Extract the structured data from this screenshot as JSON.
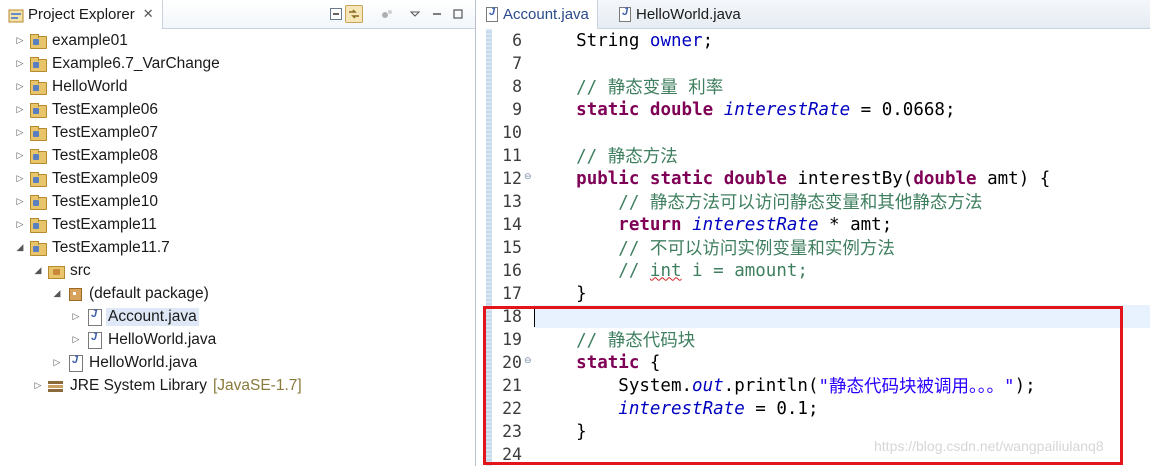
{
  "explorer": {
    "title": "Project Explorer",
    "close": "✕",
    "items": [
      {
        "label": "example01",
        "icon": "java-project-icon",
        "twisty": "▷"
      },
      {
        "label": "Example6.7_VarChange",
        "icon": "java-project-icon",
        "twisty": "▷"
      },
      {
        "label": "HelloWorld",
        "icon": "java-project-icon",
        "twisty": "▷"
      },
      {
        "label": "TestExample06",
        "icon": "java-project-icon",
        "twisty": "▷"
      },
      {
        "label": "TestExample07",
        "icon": "java-project-icon",
        "twisty": "▷"
      },
      {
        "label": "TestExample08",
        "icon": "java-project-icon",
        "twisty": "▷"
      },
      {
        "label": "TestExample09",
        "icon": "java-project-icon",
        "twisty": "▷"
      },
      {
        "label": "TestExample10",
        "icon": "java-project-icon",
        "twisty": "▷"
      },
      {
        "label": "TestExample11",
        "icon": "java-project-icon",
        "twisty": "▷"
      },
      {
        "label": "TestExample11.7",
        "icon": "java-project-icon",
        "twisty": "◢"
      },
      {
        "label": "src",
        "icon": "source-folder-icon",
        "twisty": "◢"
      },
      {
        "label": "(default package)",
        "icon": "package-icon",
        "twisty": "◢"
      },
      {
        "label": "Account.java",
        "icon": "java-file-icon",
        "twisty": "▷",
        "selected": true
      },
      {
        "label": "HelloWorld.java",
        "icon": "java-file-icon",
        "twisty": "▷"
      },
      {
        "label": "HelloWorld.java",
        "icon": "java-file-icon",
        "twisty": "▷"
      },
      {
        "label": "JRE System Library",
        "icon": "library-icon",
        "twisty": "▷",
        "decoration": "[JavaSE-1.7]"
      }
    ]
  },
  "editor": {
    "tabs": [
      {
        "label": "Account.java",
        "active": true
      },
      {
        "label": "HelloWorld.java",
        "active": false
      }
    ],
    "line_numbers": [
      "6",
      "7",
      "8",
      "9",
      "10",
      "11",
      "12",
      "13",
      "14",
      "15",
      "16",
      "17",
      "18",
      "19",
      "20",
      "21",
      "22",
      "23",
      "24"
    ],
    "folds": {
      "12": "⊖",
      "20": "⊖"
    },
    "lines": {
      "l6": {
        "a": "    String ",
        "b": "owner",
        "c": ";"
      },
      "l8": {
        "a": "    // 静态变量 利率"
      },
      "l9": {
        "a": "    ",
        "kw1": "static",
        "sp1": " ",
        "kw2": "double",
        "sp2": " ",
        "f": "interestRate",
        "c": " = 0.0668;"
      },
      "l11": {
        "a": "    // 静态方法"
      },
      "l12": {
        "a": "    ",
        "kw1": "public",
        "sp1": " ",
        "kw2": "static",
        "sp2": " ",
        "kw3": "double",
        "b": " interestBy(",
        "kw4": "double",
        "c": " amt) {"
      },
      "l13": {
        "a": "        // 静态方法可以访问静态变量和其他静态方法"
      },
      "l14": {
        "a": "        ",
        "kw": "return",
        "sp": " ",
        "f": "interestRate",
        "c": " * amt;"
      },
      "l15": {
        "a": "        // 不可以访问实例变量和实例方法"
      },
      "l16": {
        "a": "        // ",
        "u": "int",
        "c": " i = amount;"
      },
      "l17": {
        "a": "    }"
      },
      "l19": {
        "a": "    // 静态代码块"
      },
      "l20": {
        "a": "    ",
        "kw": "static",
        "c": " {"
      },
      "l21": {
        "a": "        System.",
        "f": "out",
        "b": ".println(",
        "s": "\"静态代码块被调用。。。\"",
        "c": ");"
      },
      "l22": {
        "a": "        ",
        "f": "interestRate",
        "c": " = 0.1;"
      },
      "l23": {
        "a": "    }"
      }
    }
  },
  "watermark": "https://blog.csdn.net/wangpailiulanq8",
  "colors": {
    "keyword": "#7f0055",
    "comment": "#3f7f5f",
    "field": "#0000c0",
    "string": "#2a00ff",
    "highlight_box": "#e3151a"
  }
}
